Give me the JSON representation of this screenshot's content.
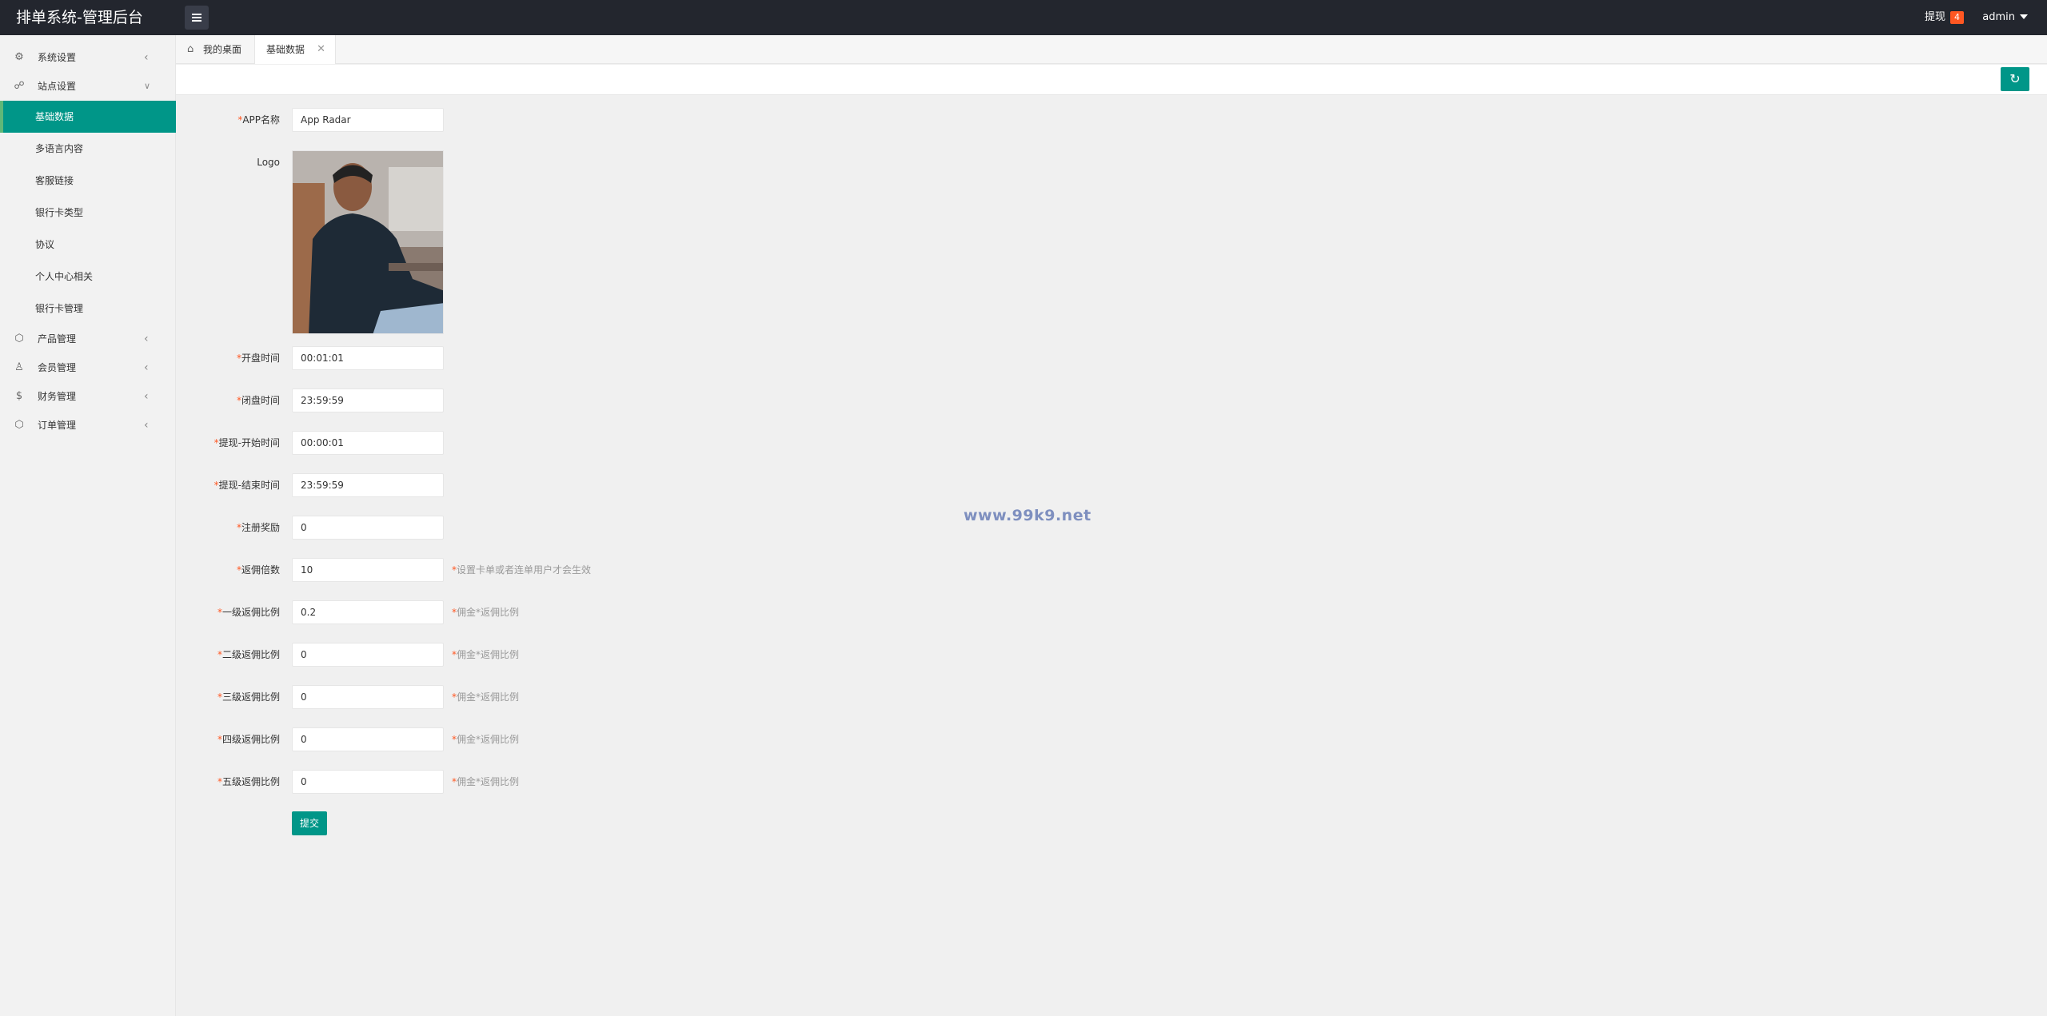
{
  "header": {
    "title": "排单系统-管理后台",
    "withdraw_label": "提现",
    "withdraw_count": "4",
    "user": "admin"
  },
  "sidebar": {
    "items": [
      {
        "label": "系统设置",
        "icon": "gear-icon"
      },
      {
        "label": "站点设置",
        "icon": "site-icon"
      },
      {
        "label": "产品管理",
        "icon": "product-icon"
      },
      {
        "label": "会员管理",
        "icon": "user-icon"
      },
      {
        "label": "财务管理",
        "icon": "dollar-icon"
      },
      {
        "label": "订单管理",
        "icon": "order-icon"
      }
    ],
    "sub_items": [
      {
        "label": "基础数据"
      },
      {
        "label": "多语言内容"
      },
      {
        "label": "客服链接"
      },
      {
        "label": "银行卡类型"
      },
      {
        "label": "协议"
      },
      {
        "label": "个人中心相关"
      },
      {
        "label": "银行卡管理"
      }
    ]
  },
  "tabs": [
    {
      "label": "我的桌面"
    },
    {
      "label": "基础数据"
    }
  ],
  "form": {
    "fields": [
      {
        "label": "APP名称",
        "value": "App Radar",
        "required": "*"
      },
      {
        "label": "Logo"
      },
      {
        "label": "开盘时间",
        "value": "00:01:01",
        "required": "*"
      },
      {
        "label": "闭盘时间",
        "value": "23:59:59",
        "required": "*"
      },
      {
        "label": "提现-开始时间",
        "value": "00:00:01",
        "required": "*"
      },
      {
        "label": "提现-结束时间",
        "value": "23:59:59",
        "required": "*"
      },
      {
        "label": "注册奖励",
        "value": "0",
        "required": "*"
      },
      {
        "label": "返佣倍数",
        "value": "10",
        "required": "*",
        "tip": "设置卡单或者连单用户才会生效"
      },
      {
        "label": "一级返佣比例",
        "value": "0.2",
        "required": "*",
        "tip": "佣金*返佣比例"
      },
      {
        "label": "二级返佣比例",
        "value": "0",
        "required": "*",
        "tip": "佣金*返佣比例"
      },
      {
        "label": "三级返佣比例",
        "value": "0",
        "required": "*",
        "tip": "佣金*返佣比例"
      },
      {
        "label": "四级返佣比例",
        "value": "0",
        "required": "*",
        "tip": "佣金*返佣比例"
      },
      {
        "label": "五级返佣比例",
        "value": "0",
        "required": "*",
        "tip": "佣金*返佣比例"
      }
    ],
    "submit_label": "提交"
  },
  "watermark": "www.99k9.net",
  "colors": {
    "header_bg": "#23262e",
    "accent": "#009688",
    "badge": "#ff5722"
  }
}
